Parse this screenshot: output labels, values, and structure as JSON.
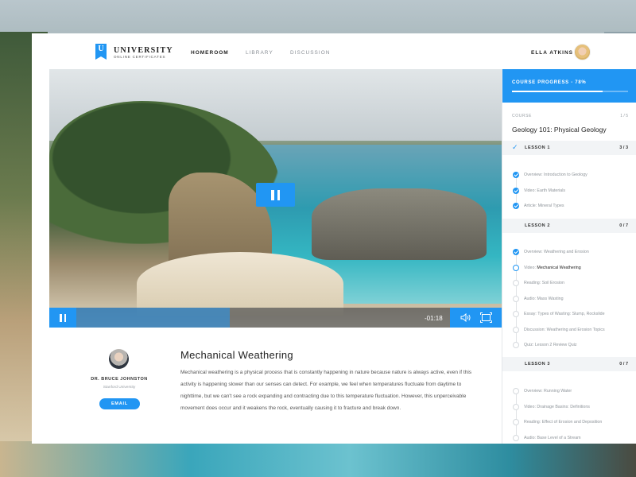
{
  "brand": {
    "badge": "U",
    "title": "UNIVERSITY",
    "subtitle": "ONLINE CERTIFICATES"
  },
  "nav": [
    "HOMEROOM",
    "LIBRARY",
    "DISCUSSION"
  ],
  "nav_active": "HOMEROOM",
  "user": {
    "name": "ELLA ATKINS"
  },
  "player": {
    "time": "-01:18",
    "progress": 0.36
  },
  "instructor": {
    "name": "DR. BRUCE JOHNSTON",
    "org": "Stanford University",
    "email_label": "EMAIL"
  },
  "lesson": {
    "title": "Mechanical Weathering",
    "body": "Mechanical weathering is a physical process that is constantly happening in nature because nature is always active, even if this activity is happening slower than our senses can detect. For example, we feel when temperatures fluctuate from daytime to nighttime, but we can't see a rock expanding and contracting due to this temperature fluctuation. However, this unperceivable movement does occur and it weakens the rock, eventually causing it to fracture and break down."
  },
  "sidebar": {
    "progress_label": "COURSE PROGRESS - 78%",
    "progress": 0.78,
    "course_label": "COURSE",
    "course_count": "1 / 5",
    "course_name": "Geology 101: Physical Geology",
    "lessons": [
      {
        "label": "LESSON 1",
        "count": "3 / 3",
        "complete": true,
        "items": [
          {
            "kind": "Overview:",
            "title": "Introduction to Geology",
            "state": "done"
          },
          {
            "kind": "Video:",
            "title": "Earth Materials",
            "state": "done"
          },
          {
            "kind": "Article:",
            "title": "Mineral Types",
            "state": "done"
          }
        ]
      },
      {
        "label": "LESSON 2",
        "count": "0 / 7",
        "complete": false,
        "items": [
          {
            "kind": "Overview:",
            "title": "Weathering and Erosion",
            "state": "done"
          },
          {
            "kind": "Video:",
            "title": "Mechanical Weathering",
            "state": "current"
          },
          {
            "kind": "Reading:",
            "title": "Soil Erosion",
            "state": "pending"
          },
          {
            "kind": "Audio:",
            "title": "Mass Wasting",
            "state": "pending"
          },
          {
            "kind": "Essay:",
            "title": "Types of Wasting: Slump, Rockslide",
            "state": "pending"
          },
          {
            "kind": "Discussion:",
            "title": "Weathering and Erosion Topics",
            "state": "pending"
          },
          {
            "kind": "Quiz:",
            "title": "Lesson 2 Review Quiz",
            "state": "pending"
          }
        ]
      },
      {
        "label": "LESSON 3",
        "count": "0 / 7",
        "complete": false,
        "items": [
          {
            "kind": "Overview:",
            "title": "Running Water",
            "state": "pending"
          },
          {
            "kind": "Video:",
            "title": "Drainage Basins: Definitions",
            "state": "pending"
          },
          {
            "kind": "Reading:",
            "title": "Effect of Erosion and Deposition",
            "state": "pending"
          },
          {
            "kind": "Audio:",
            "title": "Base Level of a Stream",
            "state": "pending"
          }
        ]
      }
    ]
  },
  "colors": {
    "accent": "#2196f3"
  },
  "icons": [
    "logo-badge-icon",
    "pause-icon",
    "volume-icon",
    "fullscreen-icon",
    "check-icon"
  ]
}
